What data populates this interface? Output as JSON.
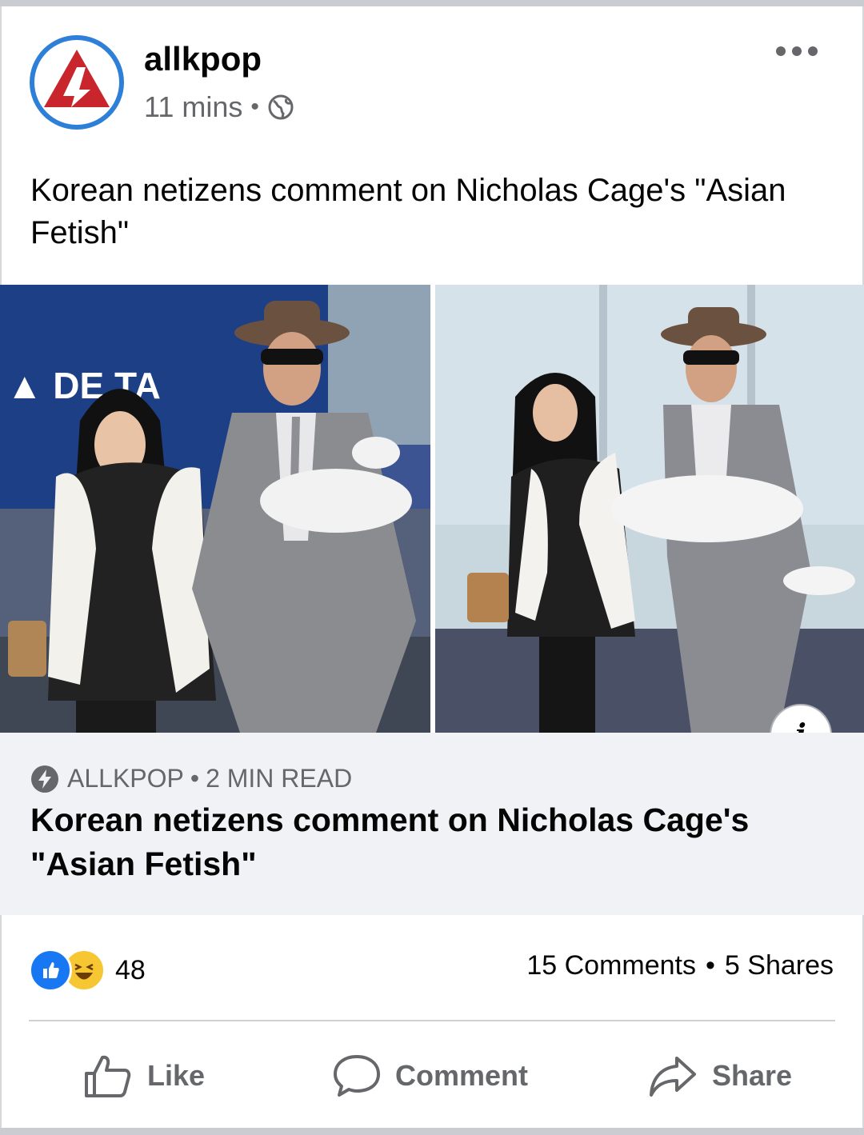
{
  "post": {
    "page_name": "allkpop",
    "time": "11 mins",
    "meta_separator": "•",
    "text": "Korean netizens comment on Nicholas Cage's \"Asian Fetish\""
  },
  "images": [
    {
      "alt": "photo-airport-left"
    },
    {
      "alt": "photo-airport-right"
    }
  ],
  "link_preview": {
    "source": "ALLKPOP",
    "separator": "•",
    "read_time": "2 MIN READ",
    "title": "Korean netizens comment on Nicholas Cage's \"Asian Fetish\"",
    "info_label": "i"
  },
  "engagement": {
    "reaction_count": "48",
    "comments": "15 Comments",
    "separator": "•",
    "shares": "5 Shares"
  },
  "actions": {
    "like": "Like",
    "comment": "Comment",
    "share": "Share"
  },
  "colors": {
    "accent": "#1877f2",
    "secondary_text": "#65676b",
    "link_box_bg": "#f0f2f5",
    "avatar_ring": "#2d7fd8",
    "avatar_logo": "#c8262c"
  },
  "icons": [
    "globe-icon",
    "more-icon",
    "bolt-icon",
    "info-icon",
    "like-reaction-icon",
    "haha-reaction-icon",
    "thumb-up-icon",
    "comment-icon",
    "share-icon"
  ]
}
